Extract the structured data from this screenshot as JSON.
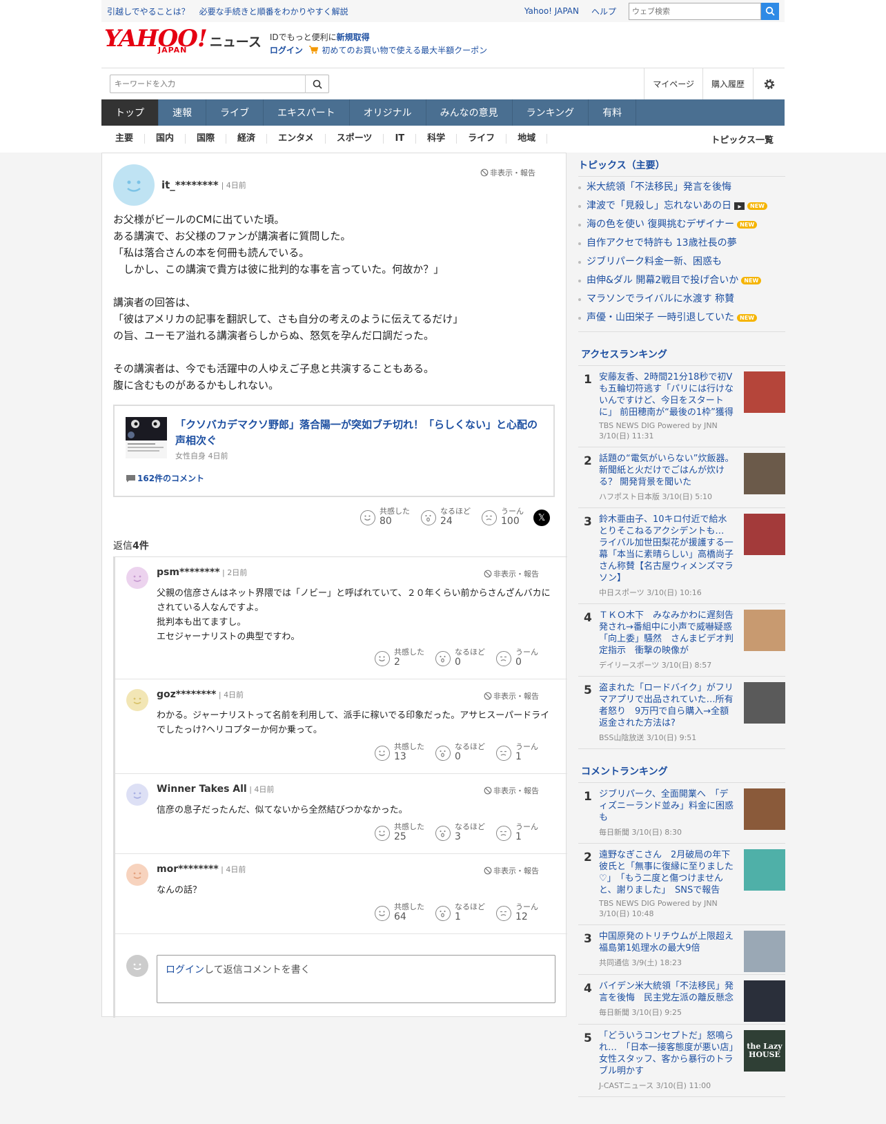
{
  "topbar": {
    "announce1": "引越しでやることは？",
    "announce2": "必要な手続きと順番をわかりやすく解説",
    "links": [
      "Yahoo! JAPAN",
      "ヘルプ"
    ],
    "search_placeholder": "ウェブ検索"
  },
  "header": {
    "logo": "YAHOO!",
    "logo_sub": "JAPAN",
    "site": "ニュース",
    "line1_prefix": "IDでもっと便利に",
    "line1_link": "新規取得",
    "line2_link": "ログイン",
    "line2_text": "初めてのお買い物で使える最大半額クーポン"
  },
  "searchrow": {
    "placeholder": "キーワードを入力",
    "mypage": "マイページ",
    "history": "購入履歴"
  },
  "nav": [
    "トップ",
    "速報",
    "ライブ",
    "エキスパート",
    "オリジナル",
    "みんなの意見",
    "ランキング",
    "有料"
  ],
  "subnav": [
    "主要",
    "国内",
    "国際",
    "経済",
    "エンタメ",
    "スポーツ",
    "IT",
    "科学",
    "ライフ",
    "地域"
  ],
  "subnav_topics": "トピックス一覧",
  "comment": {
    "user": "it_********",
    "time": "4日前",
    "hide": "非表示・報告",
    "body": "お父様がビールのCMに出ていた頃。\nある講演で、お父様のファンが講演者に質問した。\n「私は落合さんの本を何冊も読んでいる。\n　しかし、この講演で貴方は彼に批判的な事を言っていた。何故か？」\n\n講演者の回答は、\n「彼はアメリカの記事を翻訳して、さも自分の考えのように伝えてるだけ」\nの旨、ユーモア溢れる講演者らしからぬ、怒気を孕んだ口調だった。\n\nその講演者は、今でも活躍中の人ゆえご子息と共演することもある。\n腹に含むものがあるかもしれない。",
    "article_title": "「クソバカデマクソ野郎」落合陽一が突如ブチ切れ！「らしくない」と心配の声相次ぐ",
    "article_source": "女性自身 4日前",
    "article_comments": "162件のコメント",
    "reactions": {
      "agree_label": "共感した",
      "agree": "80",
      "naruhodo_label": "なるほど",
      "naruhodo": "24",
      "uun_label": "うーん",
      "uun": "100"
    },
    "replies_label": "返信",
    "replies_count": "4件"
  },
  "replies": [
    {
      "user": "psm********",
      "time": "2日前",
      "body": "父親の信彦さんはネット界隈では「ノビー」と呼ばれていて、２０年くらい前からさんざんバカにされている人なんですよ。\n批判本も出てますし。\nエセジャーナリストの典型ですわ。",
      "agree": "2",
      "naruhodo": "0",
      "uun": "0"
    },
    {
      "user": "goz********",
      "time": "4日前",
      "body": "わかる。ジャーナリストって名前を利用して、派手に稼いでる印象だった。アサヒスーパードライでしたっけ?ヘリコプターか何か乗って。",
      "agree": "13",
      "naruhodo": "0",
      "uun": "1"
    },
    {
      "user": "Winner Takes All",
      "time": "4日前",
      "body": "信彦の息子だったんだ、似てないから全然結びつかなかった。",
      "agree": "25",
      "naruhodo": "3",
      "uun": "1"
    },
    {
      "user": "mor********",
      "time": "4日前",
      "body": "なんの話？",
      "agree": "64",
      "naruhodo": "1",
      "uun": "12"
    }
  ],
  "composer": {
    "login": "ログイン",
    "text": "して返信コメントを書く"
  },
  "topics": {
    "heading": "トピックス（主要）",
    "items": [
      {
        "text": "米大統領「不法移民」発言を後悔",
        "new": false,
        "video": false
      },
      {
        "text": "津波で「見殺し」忘れないあの日",
        "new": true,
        "video": true
      },
      {
        "text": "海の色を使い 復興挑むデザイナー",
        "new": true,
        "video": false
      },
      {
        "text": "自作アクセで特許も 13歳社長の夢",
        "new": false,
        "video": false
      },
      {
        "text": "ジブリパーク料金一新、困惑も",
        "new": false,
        "video": false
      },
      {
        "text": "由伸&ダル 開幕2戦目で投げ合いか",
        "new": true,
        "video": false
      },
      {
        "text": "マラソンでライバルに水渡す 称賛",
        "new": false,
        "video": false
      },
      {
        "text": "声優・山田栄子 一時引退していた",
        "new": true,
        "video": false
      }
    ],
    "new_label": "NEW"
  },
  "access_ranking": {
    "heading": "アクセスランキング",
    "items": [
      {
        "n": "1",
        "title": "安藤友香、2時間21分18秒で初V も五輪切符逃す「パリには行けないんですけど、今日をスタートに」 前田穂南が“最後の1枠”獲得",
        "source": "TBS NEWS DIG Powered by JNN 3/10(日) 11:31",
        "color": "#b5453a"
      },
      {
        "n": "2",
        "title": "話題の“電気がいらない”炊飯器。新聞紙と火だけでごはんが炊ける？ 開発背景を聞いた",
        "source": "ハフポスト日本版 3/10(日) 5:10",
        "color": "#6b5a4a"
      },
      {
        "n": "3",
        "title": "鈴木亜由子、10キロ付近で給水とりそこねるアクシデントも… ライバル加世田梨花が援護する一幕「本当に素晴らしい」高橋尚子さん称賛【名古屋ウィメンズマラソン】",
        "source": "中日スポーツ 3/10(日) 10:16",
        "color": "#a33a3a"
      },
      {
        "n": "4",
        "title": "ＴＫＯ木下　みなみかわに遅刻告発され→番組中に小声で威嚇疑惑「向上委」騒然　さんまビデオ判定指示　衝撃の映像が",
        "source": "デイリースポーツ 3/10(日) 8:57",
        "color": "#c89a70"
      },
      {
        "n": "5",
        "title": "盗まれた「ロードバイク」がフリマアプリで出品されていた…所有者怒り　9万円で自ら購入→全額返金された方法は?",
        "source": "BSS山陰放送 3/10(日) 9:51",
        "color": "#5a5a5a"
      }
    ]
  },
  "comment_ranking": {
    "heading": "コメントランキング",
    "items": [
      {
        "n": "1",
        "title": "ジブリパーク、全面開業へ　「ディズニーランド並み」料金に困惑も",
        "source": "毎日新聞 3/10(日) 8:30",
        "color": "#8a5a3a"
      },
      {
        "n": "2",
        "title": "遠野なぎこさん　2月破局の年下彼氏と「無事に復縁に至りました♡」　「もう二度と傷つけませんと、謝りました」　SNSで報告",
        "source": "TBS NEWS DIG Powered by JNN 3/10(日) 10:48",
        "color": "#4fb0a8"
      },
      {
        "n": "3",
        "title": "中国原発のトリチウムが上限超え 福島第1処理水の最大9倍",
        "source": "共同通信 3/9(土) 18:23",
        "color": "#9aa8b5"
      },
      {
        "n": "4",
        "title": "バイデン米大統領「不法移民」発言を後悔　民主党左派の離反懸念",
        "source": "毎日新聞 3/10(日) 9:25",
        "color": "#2a2f3a"
      },
      {
        "n": "5",
        "title": "「どういうコンセプトだ」怒鳴られ…　「日本一接客態度が悪い店」女性スタッフ、客から暴行のトラブル明かす",
        "source": "J-CASTニュース 3/10(日) 11:00",
        "color": "#2f3f35",
        "img_text": "the Lazy HOUSE"
      }
    ]
  }
}
